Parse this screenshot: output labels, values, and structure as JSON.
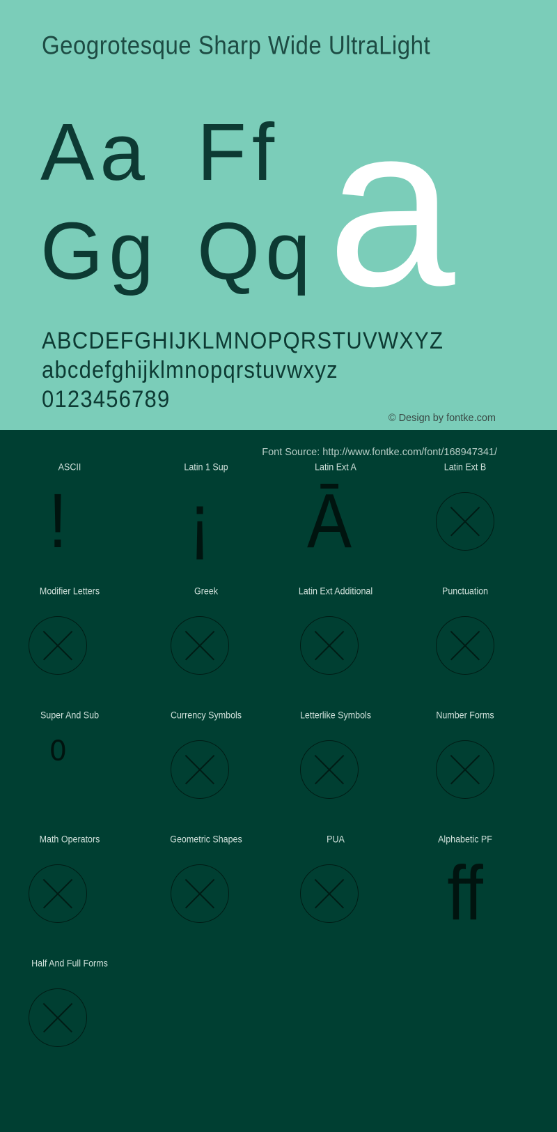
{
  "specimen": {
    "font_title": "Geogrotesque Sharp Wide UltraLight",
    "background_color": "#7bcdb9",
    "text_color": "#0d3a33",
    "highlight_glyph_color": "#ffffff",
    "glyph_pairs": [
      {
        "name": "Aa",
        "text": "Aa"
      },
      {
        "name": "Ff",
        "text": "Ff"
      },
      {
        "name": "Gg",
        "text": "Gg"
      },
      {
        "name": "Qq",
        "text": "Qq"
      }
    ],
    "featured_glyph": "a",
    "alphabet_lines": [
      "ABCDEFGHIJKLMNOPQRSTUVWXYZ",
      "abcdefghijklmnopqrstuvwxyz",
      "0123456789"
    ],
    "copyright": "© Design by fontke.com"
  },
  "dark_section": {
    "background_color": "#003f32",
    "font_source": "Font Source: http://www.fontke.com/font/168947341/",
    "unicode_blocks": [
      {
        "label": "ASCII",
        "sample": "!",
        "supported": true,
        "style": "tall"
      },
      {
        "label": "Latin 1 Sup",
        "sample": "¡",
        "supported": true,
        "style": "tall"
      },
      {
        "label": "Latin Ext A",
        "sample": "Ā",
        "supported": true,
        "style": "tall"
      },
      {
        "label": "Latin Ext B",
        "sample": "",
        "supported": false,
        "style": "missing"
      },
      {
        "label": "Modifier Letters",
        "sample": "",
        "supported": false,
        "style": "missing"
      },
      {
        "label": "Greek",
        "sample": "",
        "supported": false,
        "style": "missing"
      },
      {
        "label": "Latin Ext Additional",
        "sample": "",
        "supported": false,
        "style": "missing"
      },
      {
        "label": "Punctuation",
        "sample": "",
        "supported": false,
        "style": "missing"
      },
      {
        "label": "Super And Sub",
        "sample": "⁰",
        "supported": true,
        "style": "small"
      },
      {
        "label": "Currency Symbols",
        "sample": "",
        "supported": false,
        "style": "missing"
      },
      {
        "label": "Letterlike Symbols",
        "sample": "",
        "supported": false,
        "style": "missing"
      },
      {
        "label": "Number Forms",
        "sample": "",
        "supported": false,
        "style": "missing"
      },
      {
        "label": "Math Operators",
        "sample": "",
        "supported": false,
        "style": "missing"
      },
      {
        "label": "Geometric Shapes",
        "sample": "",
        "supported": false,
        "style": "missing"
      },
      {
        "label": "PUA",
        "sample": "",
        "supported": false,
        "style": "missing"
      },
      {
        "label": "Alphabetic PF",
        "sample": "ff",
        "supported": true,
        "style": "tall"
      },
      {
        "label": "Half And Full Forms",
        "sample": "",
        "supported": false,
        "style": "missing"
      }
    ]
  }
}
